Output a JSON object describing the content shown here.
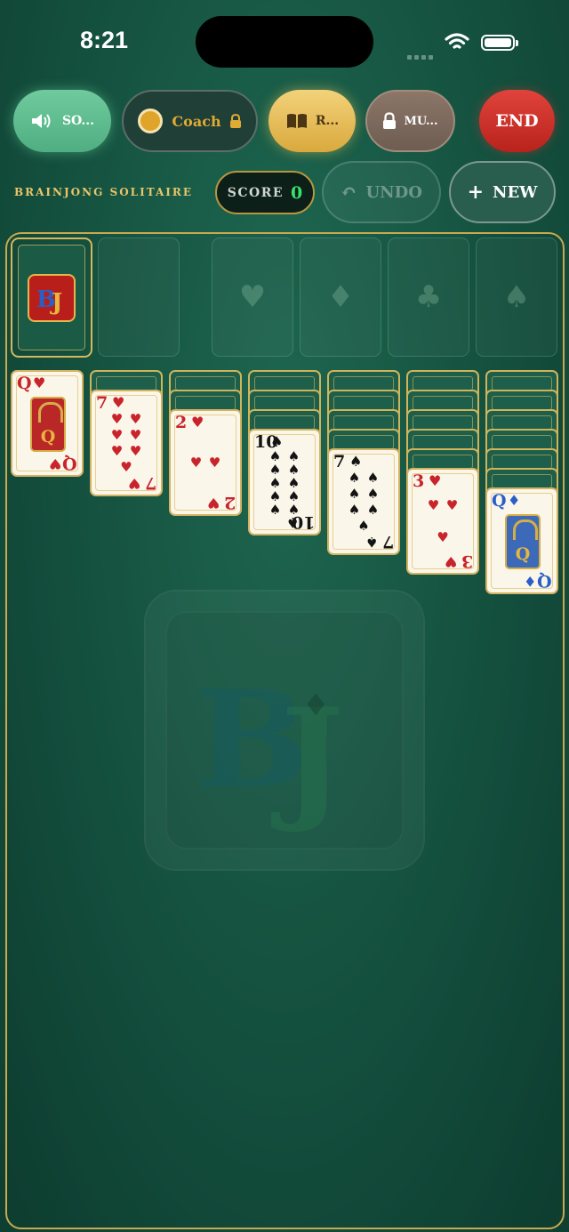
{
  "status_bar": {
    "time": "8:21"
  },
  "toolbar": {
    "sound_label": "SO...",
    "coach_label": "Coach",
    "rules_label": "R...",
    "music_label": "MU...",
    "end_label": "END"
  },
  "header": {
    "title": "BRAINJONG SOLITAIRE",
    "score_label": "SCORE",
    "score_value": "0",
    "undo_label": "UNDO",
    "new_label": "NEW"
  },
  "foundations": [
    "♥",
    "♦",
    "♣",
    "♠"
  ],
  "tableau": [
    {
      "facedown": 0,
      "rank": "Q",
      "suit": "♥",
      "color": "red"
    },
    {
      "facedown": 1,
      "rank": "7",
      "suit": "♥",
      "color": "red"
    },
    {
      "facedown": 2,
      "rank": "2",
      "suit": "♥",
      "color": "red"
    },
    {
      "facedown": 3,
      "rank": "10",
      "suit": "♠",
      "color": "black"
    },
    {
      "facedown": 4,
      "rank": "7",
      "suit": "♠",
      "color": "black"
    },
    {
      "facedown": 5,
      "rank": "3",
      "suit": "♥",
      "color": "red"
    },
    {
      "facedown": 6,
      "rank": "Q",
      "suit": "♦",
      "color": "blue"
    }
  ],
  "colors": {
    "felt": "#155240",
    "gold": "#c9a94f",
    "card_red": "#c8242b",
    "card_black": "#141414",
    "card_blue": "#2a5fc8",
    "score_green": "#39e06a"
  }
}
